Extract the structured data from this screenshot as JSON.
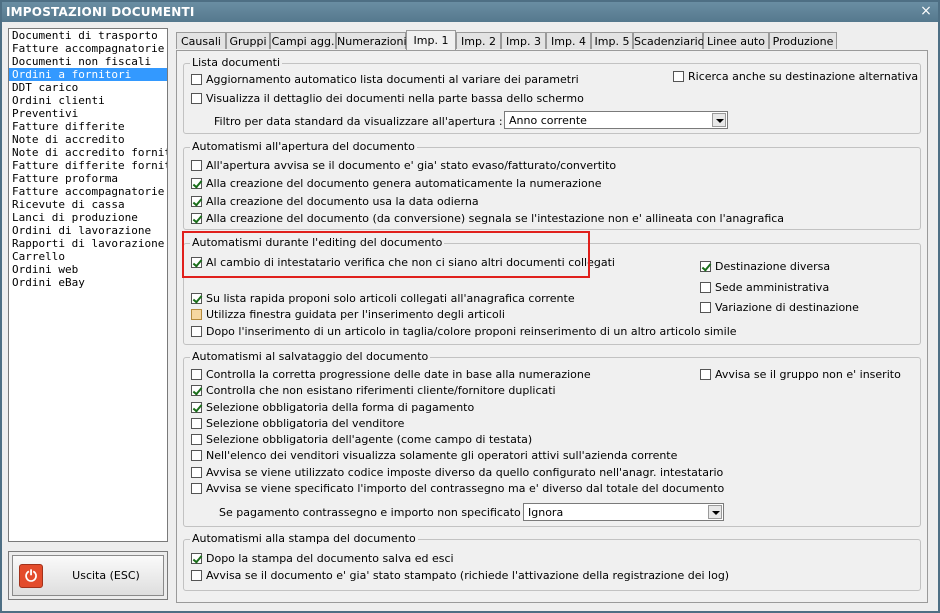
{
  "window": {
    "title": "IMPOSTAZIONI DOCUMENTI",
    "close": "×"
  },
  "sidebar": {
    "items": [
      "Documenti di trasporto",
      "Fatture accompagnatorie",
      "Documenti non fiscali",
      "Ordini a fornitori",
      "DDT carico",
      "Ordini clienti",
      "Preventivi",
      "Fatture differite",
      "Note di accredito",
      "Note di accredito fornitori",
      "Fatture differite fornitori",
      "Fatture proforma",
      "Fatture accompagnatorie fo",
      "Ricevute di cassa",
      "Lanci di produzione",
      "Ordini di lavorazione",
      "Rapporti di lavorazione",
      "Carrello",
      "Ordini web",
      "Ordini eBay"
    ],
    "selected": "Ordini a fornitori"
  },
  "exit_button": {
    "label": "Uscita (ESC)"
  },
  "tabs": [
    "Causali",
    "Gruppi",
    "Campi agg.",
    "Numerazioni",
    "Imp. 1",
    "Imp. 2",
    "Imp. 3",
    "Imp. 4",
    "Imp. 5",
    "Scadenziario",
    "Linee auto",
    "Produzione"
  ],
  "active_tab": "Imp. 1",
  "groups": {
    "lista": {
      "title": "Lista documenti",
      "aggiornamento": {
        "label": "Aggiornamento automatico lista documenti al variare dei parametri",
        "checked": false
      },
      "ricerca": {
        "label": "Ricerca anche su destinazione alternativa",
        "checked": false
      },
      "visualizza": {
        "label": "Visualizza il dettaglio dei documenti nella parte bassa dello schermo",
        "checked": false
      },
      "filtro_label": "Filtro per data standard da visualizzare all'apertura :",
      "filtro_value": "Anno corrente"
    },
    "apertura": {
      "title": "Automatismi all'apertura del documento",
      "items": [
        {
          "label": "All'apertura avvisa se il documento e' gia' stato evaso/fatturato/convertito",
          "checked": false
        },
        {
          "label": "Alla creazione del documento genera automaticamente la numerazione",
          "checked": true
        },
        {
          "label": "Alla creazione del documento usa la data odierna",
          "checked": true
        },
        {
          "label": "Alla creazione del documento (da conversione) segnala se l'intestazione non e' allineata con l'anagrafica",
          "checked": true
        }
      ]
    },
    "editing": {
      "title": "Automatismi durante l'editing del documento",
      "cambio": {
        "label": "Al cambio di intestatario verifica che non ci siano altri documenti collegati",
        "checked": true
      },
      "destinazione": {
        "label": "Destinazione diversa",
        "checked": true
      },
      "sede": {
        "label": "Sede amministrativa",
        "checked": false
      },
      "variazione": {
        "label": "Variazione di destinazione",
        "checked": false
      },
      "lista_rapida": {
        "label": "Su lista rapida proponi solo articoli collegati all'anagrafica corrente",
        "checked": true
      },
      "finestra": {
        "label": "Utilizza finestra guidata per l'inserimento degli articoli",
        "checked": false
      },
      "taglia": {
        "label": "Dopo l'inserimento di un articolo in taglia/colore proponi reinserimento di un altro articolo simile",
        "checked": false
      }
    },
    "salvataggio": {
      "title": "Automatismi al salvataggio del documento",
      "items": [
        {
          "label": "Controlla la corretta progressione delle date in base alla numerazione",
          "checked": false
        },
        {
          "label": "Controlla che non esistano riferimenti cliente/fornitore duplicati",
          "checked": true
        },
        {
          "label": "Selezione obbligatoria della forma di pagamento",
          "checked": true
        },
        {
          "label": "Selezione obbligatoria del venditore",
          "checked": false
        },
        {
          "label": "Selezione obbligatoria dell'agente (come campo di testata)",
          "checked": false
        },
        {
          "label": "Nell'elenco dei venditori visualizza solamente gli operatori attivi sull'azienda corrente",
          "checked": false
        },
        {
          "label": "Avvisa se viene utilizzato codice imposte diverso da quello configurato nell'anagr. intestatario",
          "checked": false
        },
        {
          "label": "Avvisa se viene specificato l'importo del contrassegno ma e' diverso dal totale del documento",
          "checked": false
        }
      ],
      "gruppo": {
        "label": "Avvisa se il gruppo non e' inserito",
        "checked": false
      },
      "pagamento_label": "Se pagamento contrassegno e importo non specificato :",
      "pagamento_value": "Ignora"
    },
    "stampa": {
      "title": "Automatismi alla stampa del documento",
      "items": [
        {
          "label": "Dopo la stampa del documento salva ed esci",
          "checked": true
        },
        {
          "label": "Avvisa se il documento e' gia' stato stampato (richiede l'attivazione della registrazione dei log)",
          "checked": false
        }
      ]
    }
  }
}
